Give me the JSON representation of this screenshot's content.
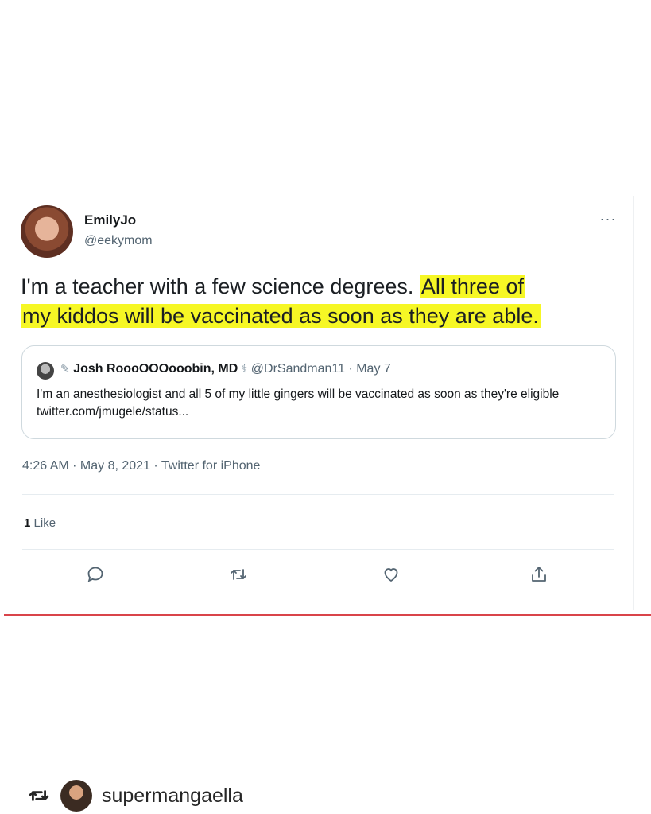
{
  "tweet": {
    "author_name": "EmilyJo",
    "author_handle": "@eekymom",
    "more_label": "···",
    "text_plain": "I'm a teacher with a few science degrees. ",
    "text_highlight_1": "All three of",
    "text_highlight_2": "my kiddos will be vaccinated as soon as they are able.",
    "quoted": {
      "name": "Josh RoooOOOooobin, MD",
      "meta": "@DrSandman11 · May 7",
      "text": "I'm an anesthesiologist and all 5 of my little gingers will be vaccinated as soon as they're eligible twitter.com/jmugele/status..."
    },
    "timestamp": "4:26 AM · May 8, 2021 · Twitter for iPhone",
    "likes_count": "1",
    "likes_label": "Like"
  },
  "actions": {
    "icons": [
      "reply-icon",
      "retweet-icon",
      "like-icon",
      "share-icon"
    ]
  },
  "repost": {
    "username": "supermangaella",
    "icon": "repost-icon"
  },
  "colors": {
    "highlight": "#f6f725",
    "red_rule": "#d9444a",
    "secondary_text": "#536471"
  }
}
